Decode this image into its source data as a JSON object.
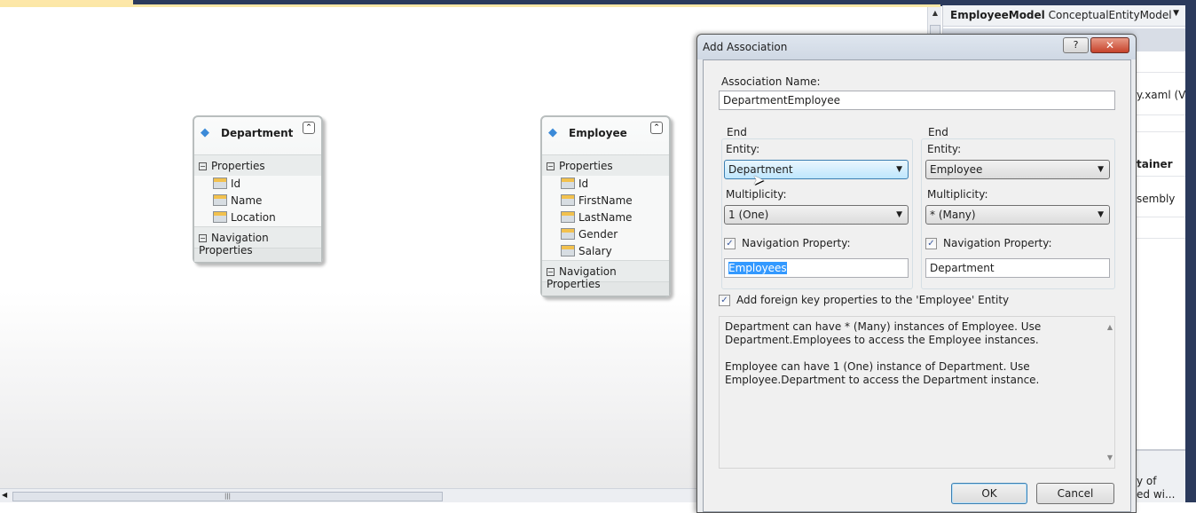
{
  "designer": {
    "entities": [
      {
        "name": "Department",
        "section_properties": "Properties",
        "properties": [
          "Id",
          "Name",
          "Location"
        ],
        "section_navigation": "Navigation Properties"
      },
      {
        "name": "Employee",
        "section_properties": "Properties",
        "properties": [
          "Id",
          "FirstName",
          "LastName",
          "Gender",
          "Salary"
        ],
        "section_navigation": "Navigation Properties"
      }
    ]
  },
  "right_panel": {
    "model_name": "EmployeeModel",
    "model_type": "ConceptualEntityModel",
    "partial_texts": [
      "y.xaml (V",
      "tainer",
      "sembly",
      "y of",
      "ed wi..."
    ]
  },
  "dialog": {
    "title": "Add Association",
    "help_label": "?",
    "close_label": "✕",
    "association_name_label": "Association Name:",
    "association_name_value": "DepartmentEmployee",
    "end1": {
      "group": "End",
      "entity_label": "Entity:",
      "entity_value": "Department",
      "multiplicity_label": "Multiplicity:",
      "multiplicity_value": "1 (One)",
      "nav_checked": true,
      "nav_label": "Navigation Property:",
      "nav_value": "Employees"
    },
    "end2": {
      "group": "End",
      "entity_label": "Entity:",
      "entity_value": "Employee",
      "multiplicity_label": "Multiplicity:",
      "multiplicity_value": "* (Many)",
      "nav_checked": true,
      "nav_label": "Navigation Property:",
      "nav_value": "Department"
    },
    "fk_checked": true,
    "fk_label": "Add foreign key properties to the 'Employee' Entity",
    "description_1": "Department can have * (Many) instances of Employee. Use Department.Employees to access the Employee instances.",
    "description_2": "Employee can have 1 (One) instance of Department. Use Employee.Department to access the Department instance.",
    "ok_label": "OK",
    "cancel_label": "Cancel"
  }
}
